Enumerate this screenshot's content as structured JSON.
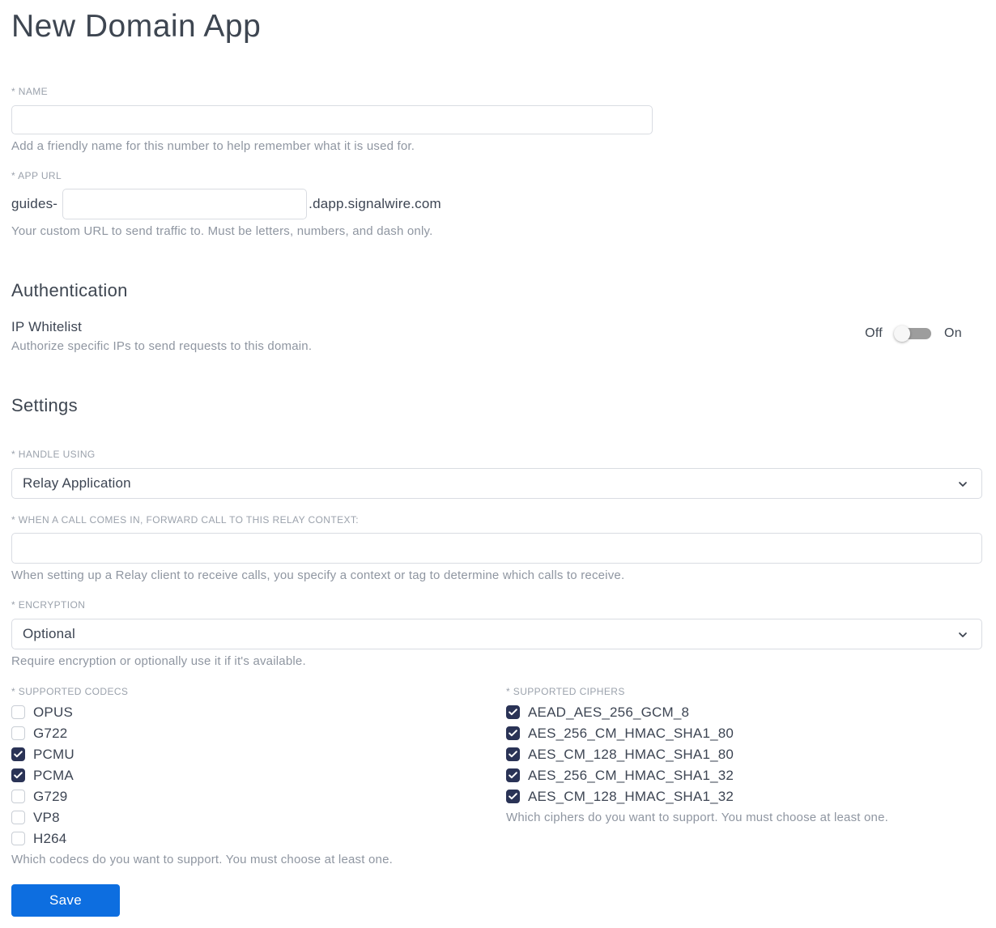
{
  "page": {
    "title": "New Domain App"
  },
  "colors": {
    "accent_blue": "#0d6ee0",
    "checkbox_navy": "#2a3356",
    "toggle_track": "#9d9d9d"
  },
  "name_field": {
    "label": "* NAME",
    "value": "",
    "placeholder": "",
    "helper": "Add a friendly name for this number to help remember what it is used for."
  },
  "app_url_field": {
    "label": "* APP URL",
    "prefix": "guides-",
    "value": "",
    "suffix": ".dapp.signalwire.com",
    "helper": "Your custom URL to send traffic to. Must be letters, numbers, and dash only."
  },
  "authentication": {
    "heading": "Authentication",
    "ip_whitelist": {
      "label": "IP Whitelist",
      "helper": "Authorize specific IPs to send requests to this domain.",
      "off_label": "Off",
      "on_label": "On",
      "state": "off"
    }
  },
  "settings": {
    "heading": "Settings",
    "handle_using": {
      "label": "* HANDLE USING",
      "selected": "Relay Application"
    },
    "relay_context": {
      "label": "* WHEN A CALL COMES IN, FORWARD CALL TO THIS RELAY CONTEXT:",
      "value": "",
      "helper": "When setting up a Relay client to receive calls, you specify a context or tag to determine which calls to receive."
    },
    "encryption": {
      "label": "* ENCRYPTION",
      "selected": "Optional",
      "helper": "Require encryption or optionally use it if it's available."
    },
    "codecs": {
      "label": "* SUPPORTED CODECS",
      "helper": "Which codecs do you want to support. You must choose at least one.",
      "items": [
        {
          "label": "OPUS",
          "checked": false
        },
        {
          "label": "G722",
          "checked": false
        },
        {
          "label": "PCMU",
          "checked": true
        },
        {
          "label": "PCMA",
          "checked": true
        },
        {
          "label": "G729",
          "checked": false
        },
        {
          "label": "VP8",
          "checked": false
        },
        {
          "label": "H264",
          "checked": false
        }
      ]
    },
    "ciphers": {
      "label": "* SUPPORTED CIPHERS",
      "helper": "Which ciphers do you want to support. You must choose at least one.",
      "items": [
        {
          "label": "AEAD_AES_256_GCM_8",
          "checked": true
        },
        {
          "label": "AES_256_CM_HMAC_SHA1_80",
          "checked": true
        },
        {
          "label": "AES_CM_128_HMAC_SHA1_80",
          "checked": true
        },
        {
          "label": "AES_256_CM_HMAC_SHA1_32",
          "checked": true
        },
        {
          "label": "AES_CM_128_HMAC_SHA1_32",
          "checked": true
        }
      ]
    }
  },
  "actions": {
    "save_label": "Save"
  }
}
